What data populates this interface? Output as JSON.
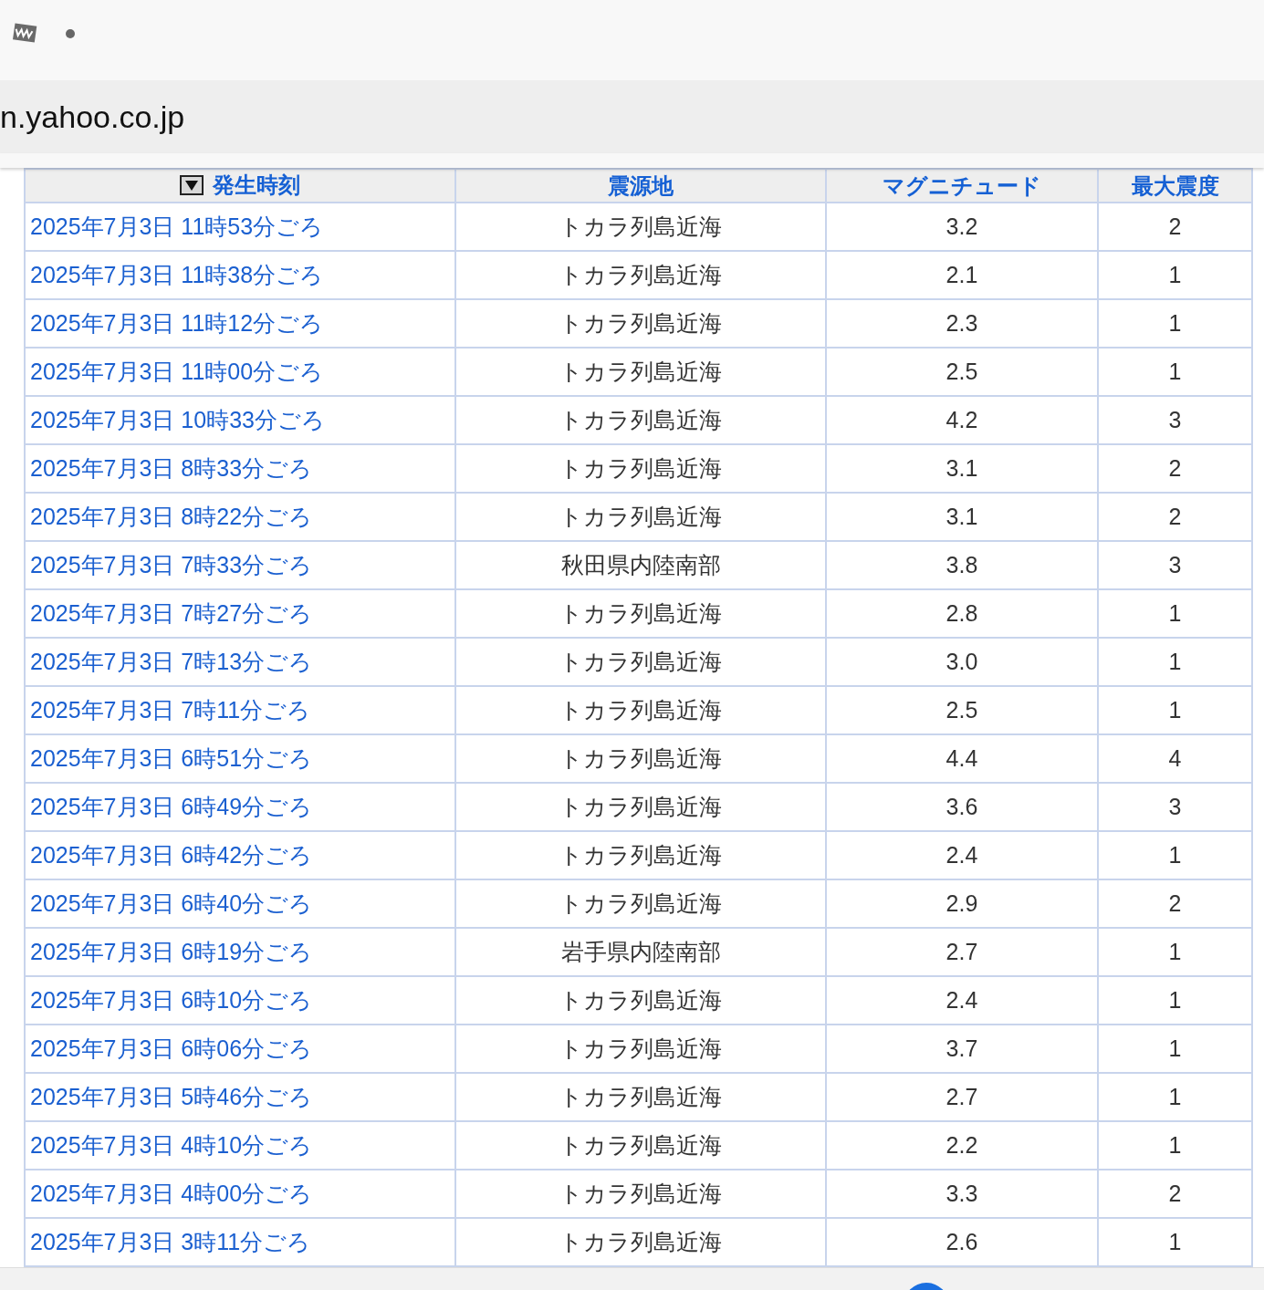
{
  "browser": {
    "url": "n.yahoo.co.jp"
  },
  "table": {
    "columns": [
      {
        "label": "発生時刻",
        "sorted": true
      },
      {
        "label": "震源地",
        "sorted": false
      },
      {
        "label": "マグニチュード",
        "sorted": false
      },
      {
        "label": "最大震度",
        "sorted": false
      }
    ],
    "rows": [
      [
        "2025年7月3日 11時53分ごろ",
        "トカラ列島近海",
        "3.2",
        "2"
      ],
      [
        "2025年7月3日 11時38分ごろ",
        "トカラ列島近海",
        "2.1",
        "1"
      ],
      [
        "2025年7月3日 11時12分ごろ",
        "トカラ列島近海",
        "2.3",
        "1"
      ],
      [
        "2025年7月3日 11時00分ごろ",
        "トカラ列島近海",
        "2.5",
        "1"
      ],
      [
        "2025年7月3日 10時33分ごろ",
        "トカラ列島近海",
        "4.2",
        "3"
      ],
      [
        "2025年7月3日 8時33分ごろ",
        "トカラ列島近海",
        "3.1",
        "2"
      ],
      [
        "2025年7月3日 8時22分ごろ",
        "トカラ列島近海",
        "3.1",
        "2"
      ],
      [
        "2025年7月3日 7時33分ごろ",
        "秋田県内陸南部",
        "3.8",
        "3"
      ],
      [
        "2025年7月3日 7時27分ごろ",
        "トカラ列島近海",
        "2.8",
        "1"
      ],
      [
        "2025年7月3日 7時13分ごろ",
        "トカラ列島近海",
        "3.0",
        "1"
      ],
      [
        "2025年7月3日 7時11分ごろ",
        "トカラ列島近海",
        "2.5",
        "1"
      ],
      [
        "2025年7月3日 6時51分ごろ",
        "トカラ列島近海",
        "4.4",
        "4"
      ],
      [
        "2025年7月3日 6時49分ごろ",
        "トカラ列島近海",
        "3.6",
        "3"
      ],
      [
        "2025年7月3日 6時42分ごろ",
        "トカラ列島近海",
        "2.4",
        "1"
      ],
      [
        "2025年7月3日 6時40分ごろ",
        "トカラ列島近海",
        "2.9",
        "2"
      ],
      [
        "2025年7月3日 6時19分ごろ",
        "岩手県内陸南部",
        "2.7",
        "1"
      ],
      [
        "2025年7月3日 6時10分ごろ",
        "トカラ列島近海",
        "2.4",
        "1"
      ],
      [
        "2025年7月3日 6時06分ごろ",
        "トカラ列島近海",
        "3.7",
        "1"
      ],
      [
        "2025年7月3日 5時46分ごろ",
        "トカラ列島近海",
        "2.7",
        "1"
      ],
      [
        "2025年7月3日 4時10分ごろ",
        "トカラ列島近海",
        "2.2",
        "1"
      ],
      [
        "2025年7月3日 4時00分ごろ",
        "トカラ列島近海",
        "3.3",
        "2"
      ],
      [
        "2025年7月3日 3時11分ごろ",
        "トカラ列島近海",
        "2.6",
        "1"
      ]
    ]
  }
}
